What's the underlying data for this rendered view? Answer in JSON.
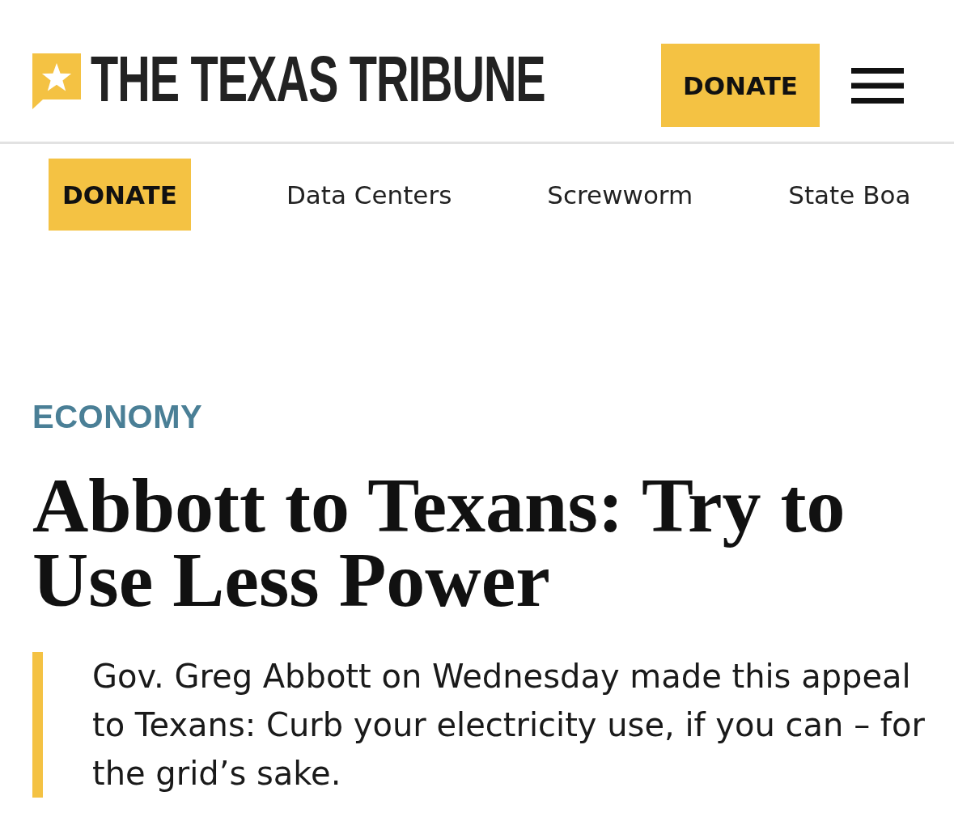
{
  "header": {
    "logo": {
      "text": "THE TEXAS TRIBUNE"
    },
    "donate_button": {
      "label": "DONATE"
    }
  },
  "nav": {
    "items": [
      {
        "label": "DONATE",
        "kind": "donate"
      },
      {
        "label": "Data Centers",
        "kind": "link"
      },
      {
        "label": "Screwworm",
        "kind": "link"
      },
      {
        "label": "State Boa",
        "kind": "link"
      }
    ]
  },
  "article": {
    "section": "ECONOMY",
    "headline": "Abbott to Texans: Try to Use Less Power",
    "dek": "Gov. Greg Abbott on Wednesday made this appeal to Texans: Curb your electricity use, if you can – for the grid’s sake."
  }
}
